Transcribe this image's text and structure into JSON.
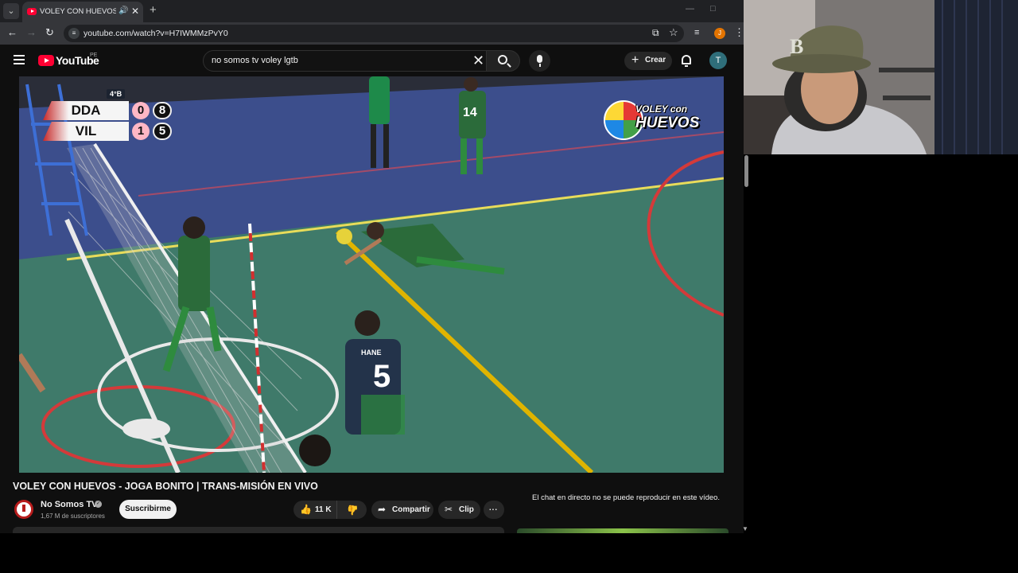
{
  "browser": {
    "tab_title": "VOLEY CON HUEVOS - JOGA BONITO",
    "url": "youtube.com/watch?v=H7IWMMzPvY0",
    "tab_list_glyph": "⌄",
    "new_tab_glyph": "+",
    "minimize_glyph": "—",
    "maximize_glyph": "□",
    "close_glyph": "✕",
    "profile_initial": "J"
  },
  "youtube": {
    "logo_text": "YouTube",
    "country_code": "PE",
    "search_value": "no somos tv voley lgtb",
    "create_label": "Crear",
    "account_initial": "T"
  },
  "video": {
    "scoreboard": {
      "set_label": "4°B",
      "teams": [
        {
          "name": "DDA",
          "sets": "0",
          "points": "8"
        },
        {
          "name": "VIL",
          "sets": "1",
          "points": "5"
        }
      ]
    },
    "watermark": {
      "line1": "VOLEY con",
      "line2": "HUEVOS"
    },
    "title": "VOLEY CON HUEVOS - JOGA BONITO | TRANS-MISIÓN EN VIVO"
  },
  "channel": {
    "name": "No Somos TV",
    "subscribers": "1,67 M de suscriptores",
    "subscribe_label": "Suscribirme"
  },
  "actions": {
    "like_count": "11 K",
    "share_label": "Compartir",
    "clip_label": "Clip"
  },
  "chat": {
    "message": "El chat en directo no se puede reproducir en este vídeo."
  },
  "icons": [
    "tab-list-icon",
    "youtube-favicon",
    "audio-icon",
    "close-icon",
    "plus-icon",
    "back-icon",
    "forward-icon",
    "reload-icon",
    "site-info-icon",
    "install-icon",
    "bookmark-icon",
    "queue-icon",
    "kebab-icon",
    "hamburger-icon",
    "youtube-logo-icon",
    "search-clear-icon",
    "search-icon",
    "mic-icon",
    "bell-icon",
    "verified-icon",
    "like-icon",
    "dislike-icon",
    "share-icon",
    "scissors-icon",
    "more-icon"
  ],
  "colors": {
    "brand_red": "#ff0033",
    "dark_bg": "#0f0f0f",
    "chip_bg": "#272727"
  }
}
